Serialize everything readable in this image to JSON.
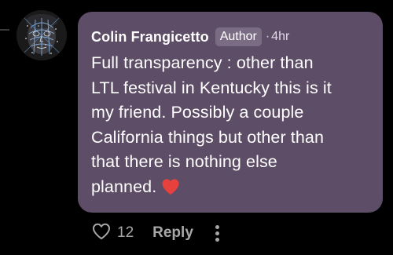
{
  "comment": {
    "author": "Colin Frangicetto",
    "badge": "Author",
    "separator": "·",
    "timestamp": "4hr",
    "body_lines": [
      "Full transparency  : other than",
      "LTL festival in Kentucky this is it",
      "my friend. Possibly a couple",
      "California things but other than",
      "that there is nothing else",
      "planned."
    ],
    "emoji": "heart-emoji"
  },
  "actions": {
    "like_icon": "heart-outline-icon",
    "like_count": "12",
    "reply_label": "Reply",
    "more_icon": "vertical-ellipsis-icon"
  },
  "colors": {
    "background": "#000000",
    "bubble": "#5d4d66",
    "badge": "#7a6c83",
    "text": "#ffffff",
    "muted": "#a8a8a8",
    "heart": "#e8403c"
  }
}
